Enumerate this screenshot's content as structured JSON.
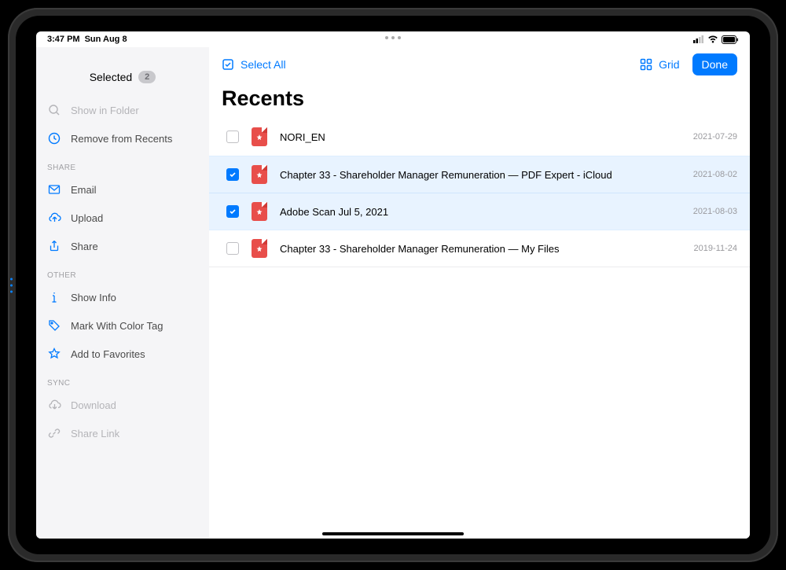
{
  "status": {
    "time": "3:47 PM",
    "date": "Sun Aug 8"
  },
  "sidebar": {
    "selected_label": "Selected",
    "selected_count": "2",
    "actions": {
      "show_in_folder": "Show in Folder",
      "remove_recents": "Remove from Recents"
    },
    "share_header": "SHARE",
    "share": {
      "email": "Email",
      "upload": "Upload",
      "share": "Share"
    },
    "other_header": "OTHER",
    "other": {
      "show_info": "Show Info",
      "color_tag": "Mark With Color Tag",
      "favorites": "Add to Favorites"
    },
    "sync_header": "SYNC",
    "sync": {
      "download": "Download",
      "share_link": "Share Link"
    }
  },
  "toolbar": {
    "select_all": "Select All",
    "grid": "Grid",
    "done": "Done"
  },
  "page_title": "Recents",
  "files": [
    {
      "name": "NORI_EN",
      "date": "2021-07-29",
      "selected": false
    },
    {
      "name": "Chapter 33 - Shareholder Manager Remuneration — PDF Expert - iCloud",
      "date": "2021-08-02",
      "selected": true
    },
    {
      "name": "Adobe Scan Jul 5, 2021",
      "date": "2021-08-03",
      "selected": true
    },
    {
      "name": "Chapter 33 - Shareholder Manager Remuneration — My Files",
      "date": "2019-11-24",
      "selected": false
    }
  ],
  "colors": {
    "accent": "#007aff",
    "pdf": "#e84e4a"
  }
}
